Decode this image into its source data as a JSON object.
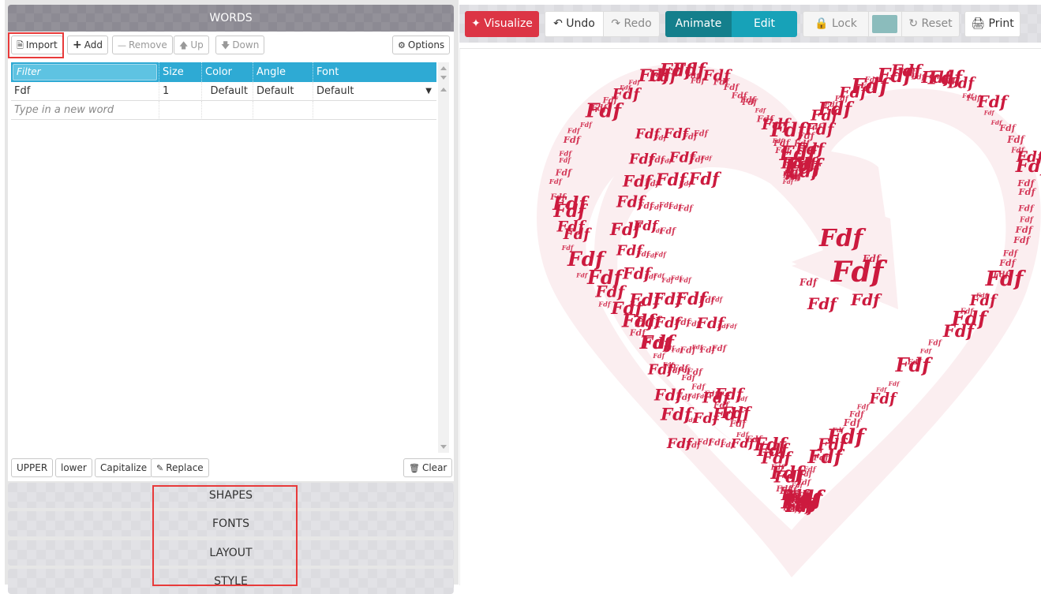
{
  "words_panel": {
    "title": "WORDS",
    "toolbar": {
      "import": "Import",
      "add": "Add",
      "remove": "Remove",
      "up": "Up",
      "down": "Down",
      "options": "Options"
    },
    "table": {
      "filter_placeholder": "Filter",
      "columns": [
        "Size",
        "Color",
        "Angle",
        "Font"
      ],
      "rows": [
        {
          "word": "Fdf",
          "size": "1",
          "color": "Default",
          "angle": "Default",
          "font": "Default"
        }
      ],
      "new_word_placeholder": "Type in a new word"
    },
    "bottom_toolbar": {
      "upper": "UPPER",
      "lower": "lower",
      "capitalize": "Capitalize",
      "replace": "Replace",
      "clear": "Clear"
    }
  },
  "sections": [
    "SHAPES",
    "FONTS",
    "LAYOUT",
    "STYLE"
  ],
  "main_toolbar": {
    "visualize": "Visualize",
    "undo": "Undo",
    "redo": "Redo",
    "animate": "Animate",
    "edit": "Edit",
    "lock": "Lock",
    "reset": "Reset",
    "print": "Print",
    "swatch_color": "#8bbcbc"
  },
  "canvas": {
    "word": "Fdf",
    "word_color": "#cc1a3e",
    "shape": "heart with inner arrow",
    "shape_fill": "#fbeef0"
  },
  "colors": {
    "visualize": "#dc3545",
    "animate": "#147f8c",
    "edit": "#17a2b8",
    "grid_header": "#2eaad4",
    "highlight": "#e83a3a"
  }
}
